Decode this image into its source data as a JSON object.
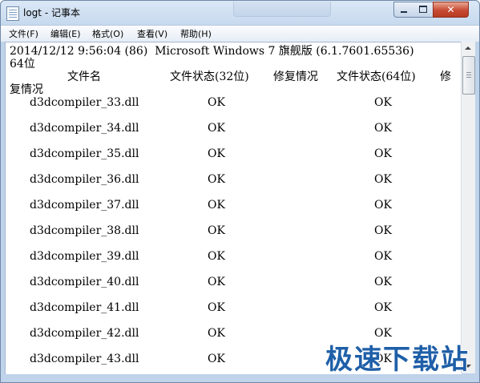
{
  "window": {
    "title": "logt - 记事本"
  },
  "menu": [
    "文件(F)",
    "编辑(E)",
    "格式(O)",
    "查看(V)",
    "帮助(H)"
  ],
  "document": {
    "header_line1": "2014/12/12 9:56:04 (86)  Microsoft Windows 7 旗舰版 (6.1.7601.65536)",
    "header_line2": "64位",
    "col_filename": "文件名",
    "col_status32": "文件状态(32位)",
    "col_fix32": "修复情况",
    "col_status64": "文件状态(64位)",
    "col_fix64_part": "修",
    "col_fix64_wrap": "复情况",
    "rows": [
      {
        "file": "d3dcompiler_33.dll",
        "s32": "OK",
        "s64": "OK"
      },
      {
        "file": "d3dcompiler_34.dll",
        "s32": "OK",
        "s64": "OK"
      },
      {
        "file": "d3dcompiler_35.dll",
        "s32": "OK",
        "s64": "OK"
      },
      {
        "file": "d3dcompiler_36.dll",
        "s32": "OK",
        "s64": "OK"
      },
      {
        "file": "d3dcompiler_37.dll",
        "s32": "OK",
        "s64": "OK"
      },
      {
        "file": "d3dcompiler_38.dll",
        "s32": "OK",
        "s64": "OK"
      },
      {
        "file": "d3dcompiler_39.dll",
        "s32": "OK",
        "s64": "OK"
      },
      {
        "file": "d3dcompiler_40.dll",
        "s32": "OK",
        "s64": "OK"
      },
      {
        "file": "d3dcompiler_41.dll",
        "s32": "OK",
        "s64": "OK"
      },
      {
        "file": "d3dcompiler_42.dll",
        "s32": "OK",
        "s64": "OK"
      },
      {
        "file": "d3dcompiler_43.dll",
        "s32": "OK",
        "s64": "OK"
      }
    ]
  },
  "watermark": "极速下载站",
  "icons": {
    "app": "notepad-icon",
    "minimize": "minimize-icon",
    "maximize": "maximize-icon",
    "close": "close-icon",
    "scroll_up": "scroll-up-arrow-icon",
    "scroll_down": "scroll-down-arrow-icon"
  },
  "colors": {
    "title_gradient_top": "#dbe8f6",
    "close_button": "#c74a33",
    "watermark": "#1f5fa8"
  }
}
